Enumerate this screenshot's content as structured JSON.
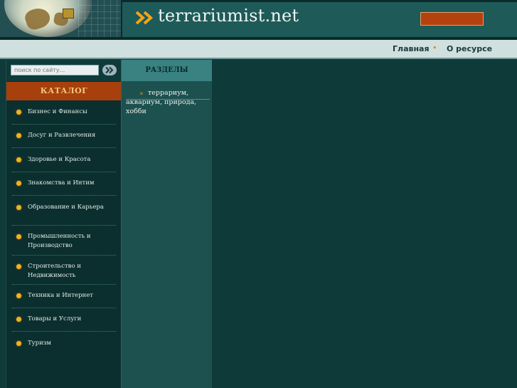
{
  "header": {
    "site_name": "terrariumist.net",
    "colors": {
      "accent": "#b4420e",
      "brand_bg": "#1e5a58",
      "arrow": "#f2a418"
    }
  },
  "topnav": {
    "items": [
      {
        "label": "Главная"
      },
      {
        "label": "О ресурсе"
      }
    ],
    "separator": "•"
  },
  "search": {
    "placeholder": "поиск по сайту...",
    "button_icon": "double-chevron-right-icon"
  },
  "catalog": {
    "title": "КАТАЛОГ",
    "items": [
      {
        "label": "Бизнес и Финансы"
      },
      {
        "label": "Досуг и Развлечения"
      },
      {
        "label": "Здоровье и Красота"
      },
      {
        "label": "Знакомства и Интим"
      },
      {
        "label": "Образование и Карьера"
      },
      {
        "line1": "Промышленность и",
        "line2": "Производство"
      },
      {
        "line1": "Строительство и",
        "line2": "Недвижимость"
      },
      {
        "label": "Техника и Интернет"
      },
      {
        "label": "Товары и Услуги"
      },
      {
        "label": "Туризм"
      }
    ]
  },
  "sections": {
    "title": "РАЗДЕЛЫ",
    "line1": "террариум,",
    "line2": "аквариум, природа, хобби"
  }
}
